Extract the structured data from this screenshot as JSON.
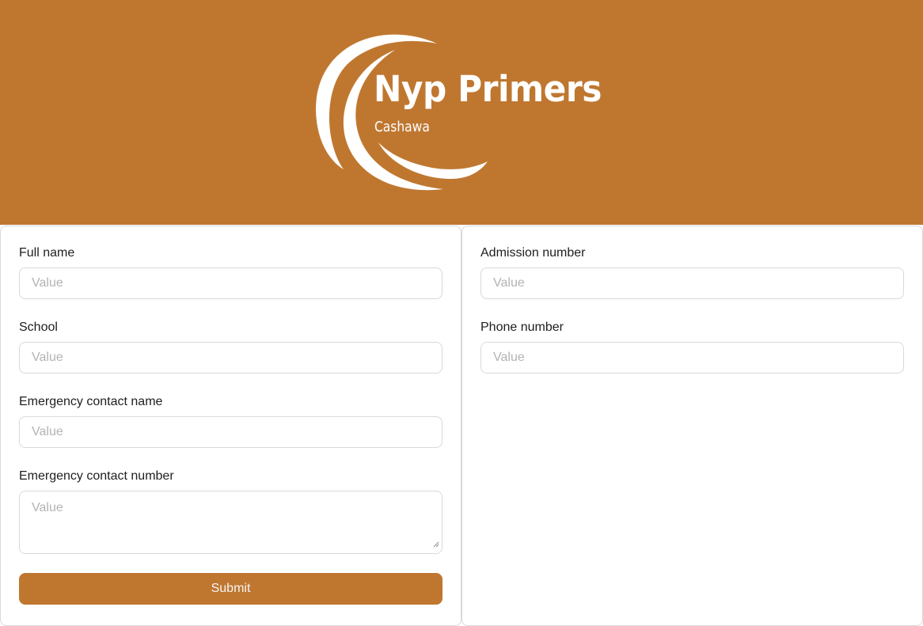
{
  "brand": {
    "title": "Nyp Primers",
    "subtitle": "Cashawa",
    "color": "#bf7730"
  },
  "form_left": {
    "fields": [
      {
        "label": "Full name",
        "placeholder": "Value"
      },
      {
        "label": "School",
        "placeholder": "Value"
      },
      {
        "label": "Emergency contact name",
        "placeholder": "Value"
      },
      {
        "label": "Emergency contact number",
        "placeholder": "Value"
      }
    ],
    "submit_label": "Submit"
  },
  "form_right": {
    "fields": [
      {
        "label": "Admission number",
        "placeholder": "Value"
      },
      {
        "label": "Phone number",
        "placeholder": "Value"
      }
    ]
  },
  "icons": {
    "logo": "crescent-logo-icon",
    "textarea_resize": "resize-handle-icon"
  }
}
